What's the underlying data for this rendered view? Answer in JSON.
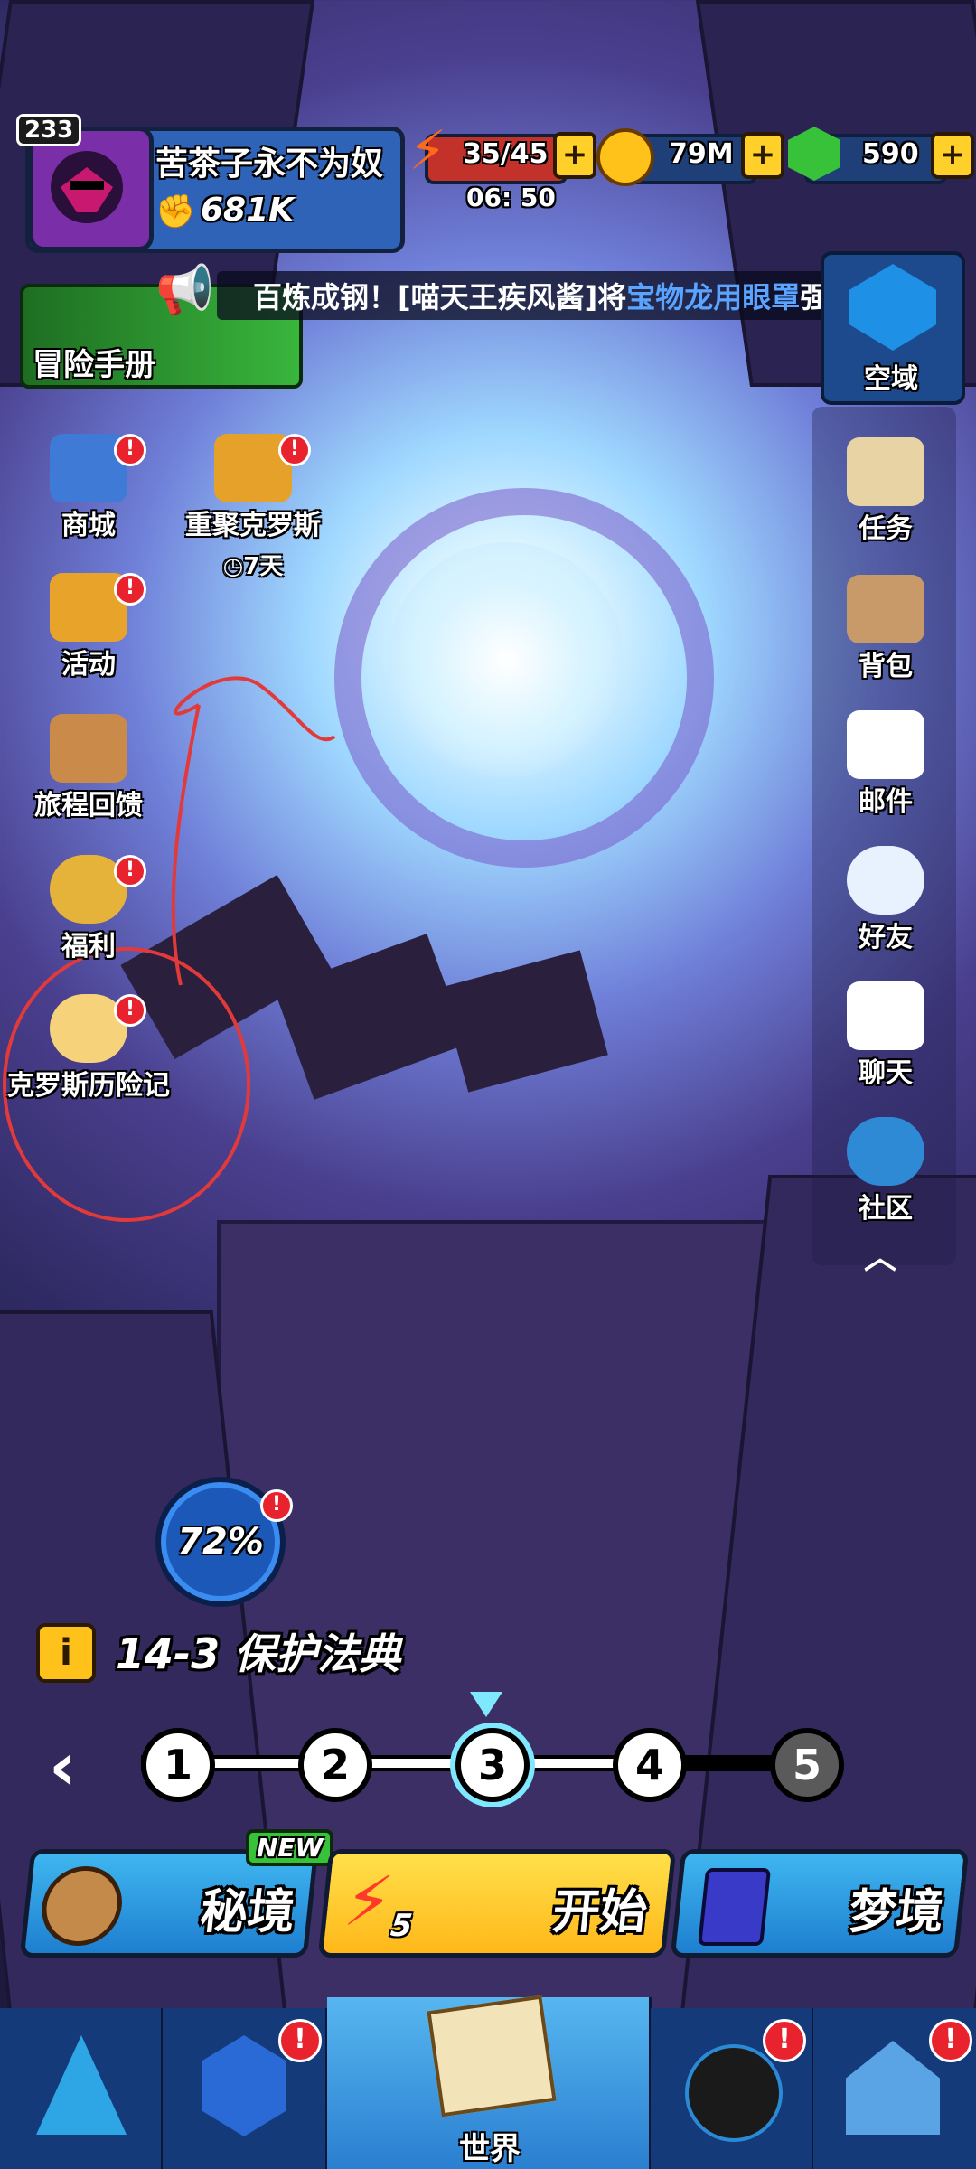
{
  "player": {
    "level": "233",
    "name": "苦茶子永不为奴",
    "power": "681K"
  },
  "resources": {
    "energy": "35/45",
    "energy_timer": "06: 50",
    "gold": "79M",
    "gems": "590"
  },
  "ticker": {
    "text": "百炼成钢！[喵天王疾风酱]将",
    "highlight": "宝物龙用眼罩",
    "suffix": "强"
  },
  "adventure_manual": {
    "label": "冒险手册"
  },
  "sky_domain": {
    "label": "空域"
  },
  "left_menu": [
    {
      "label": "商城"
    },
    {
      "label": "重聚克罗斯",
      "timer": "7天"
    },
    {
      "label": "活动"
    },
    {
      "label": "旅程回馈"
    },
    {
      "label": "福利"
    },
    {
      "label": "克罗斯历险记"
    }
  ],
  "right_menu": [
    {
      "label": "任务"
    },
    {
      "label": "背包"
    },
    {
      "label": "邮件"
    },
    {
      "label": "好友"
    },
    {
      "label": "聊天"
    },
    {
      "label": "社区"
    }
  ],
  "progress": {
    "percent": "72%"
  },
  "stage": {
    "info_icon": "i",
    "title": "14-3 保护法典"
  },
  "stage_nodes": [
    "1",
    "2",
    "3",
    "4",
    "5"
  ],
  "actions": {
    "secret": {
      "label": "秘境",
      "badge": "NEW"
    },
    "start": {
      "label": "开始",
      "cost": "5"
    },
    "dream": {
      "label": "梦境"
    }
  },
  "bottom_nav": {
    "world": "世界"
  },
  "colors": {
    "accent_yellow": "#ffd02a",
    "panel_blue": "#2f63b8",
    "alert_red": "#e8232d"
  }
}
